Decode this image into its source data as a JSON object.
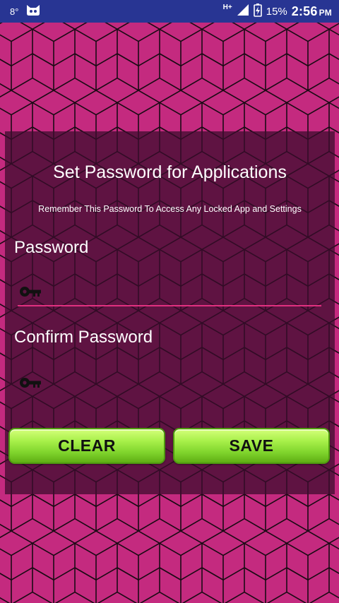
{
  "status_bar": {
    "temperature": "8°",
    "network": "H+",
    "battery_percent": "15%",
    "time": "2:56",
    "ampm": "PM",
    "icons": [
      "cat-face-icon",
      "signal-icon",
      "battery-charging-icon"
    ],
    "background_color": "#283593"
  },
  "dialog": {
    "title": "Set Password for Applications",
    "subtitle": "Remember This Password To Access Any Locked App and Settings",
    "password": {
      "label": "Password",
      "value": "",
      "icon": "key-icon"
    },
    "confirm_password": {
      "label": "Confirm Password",
      "value": "",
      "icon": "key-icon"
    },
    "buttons": {
      "clear_label": "CLEAR",
      "save_label": "SAVE"
    }
  },
  "colors": {
    "background": "#c42a7f",
    "panel": "#3c0c2d",
    "accent_underline": "#e0307f",
    "button_green": "#a8f04a"
  }
}
